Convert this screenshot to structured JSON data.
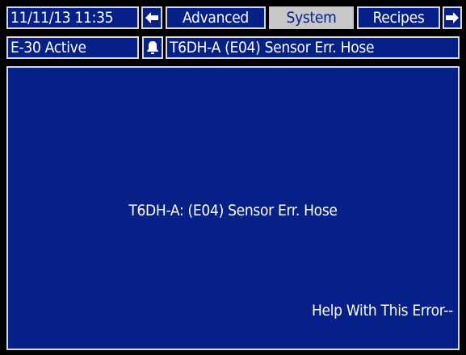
{
  "header": {
    "datetime": "11/11/13 11:35",
    "tabs": [
      {
        "label": "Advanced",
        "active": false
      },
      {
        "label": "System",
        "active": true
      },
      {
        "label": "Recipes",
        "active": false
      }
    ],
    "prev_icon": "left-arrow-icon",
    "next_icon": "right-arrow-icon"
  },
  "status": {
    "error_code": "E-30 Active",
    "alarm_icon": "bell-alarm-icon",
    "error_message": "T6DH-A (E04) Sensor Err. Hose"
  },
  "main": {
    "error_description": "T6DH-A: (E04) Sensor Err. Hose",
    "help_link": "Help With This Error--"
  },
  "colors": {
    "panel_bg": "#06208a",
    "active_tab_bg": "#c8c8c8",
    "border": "#d9d9d9",
    "text": "#ffffff"
  }
}
